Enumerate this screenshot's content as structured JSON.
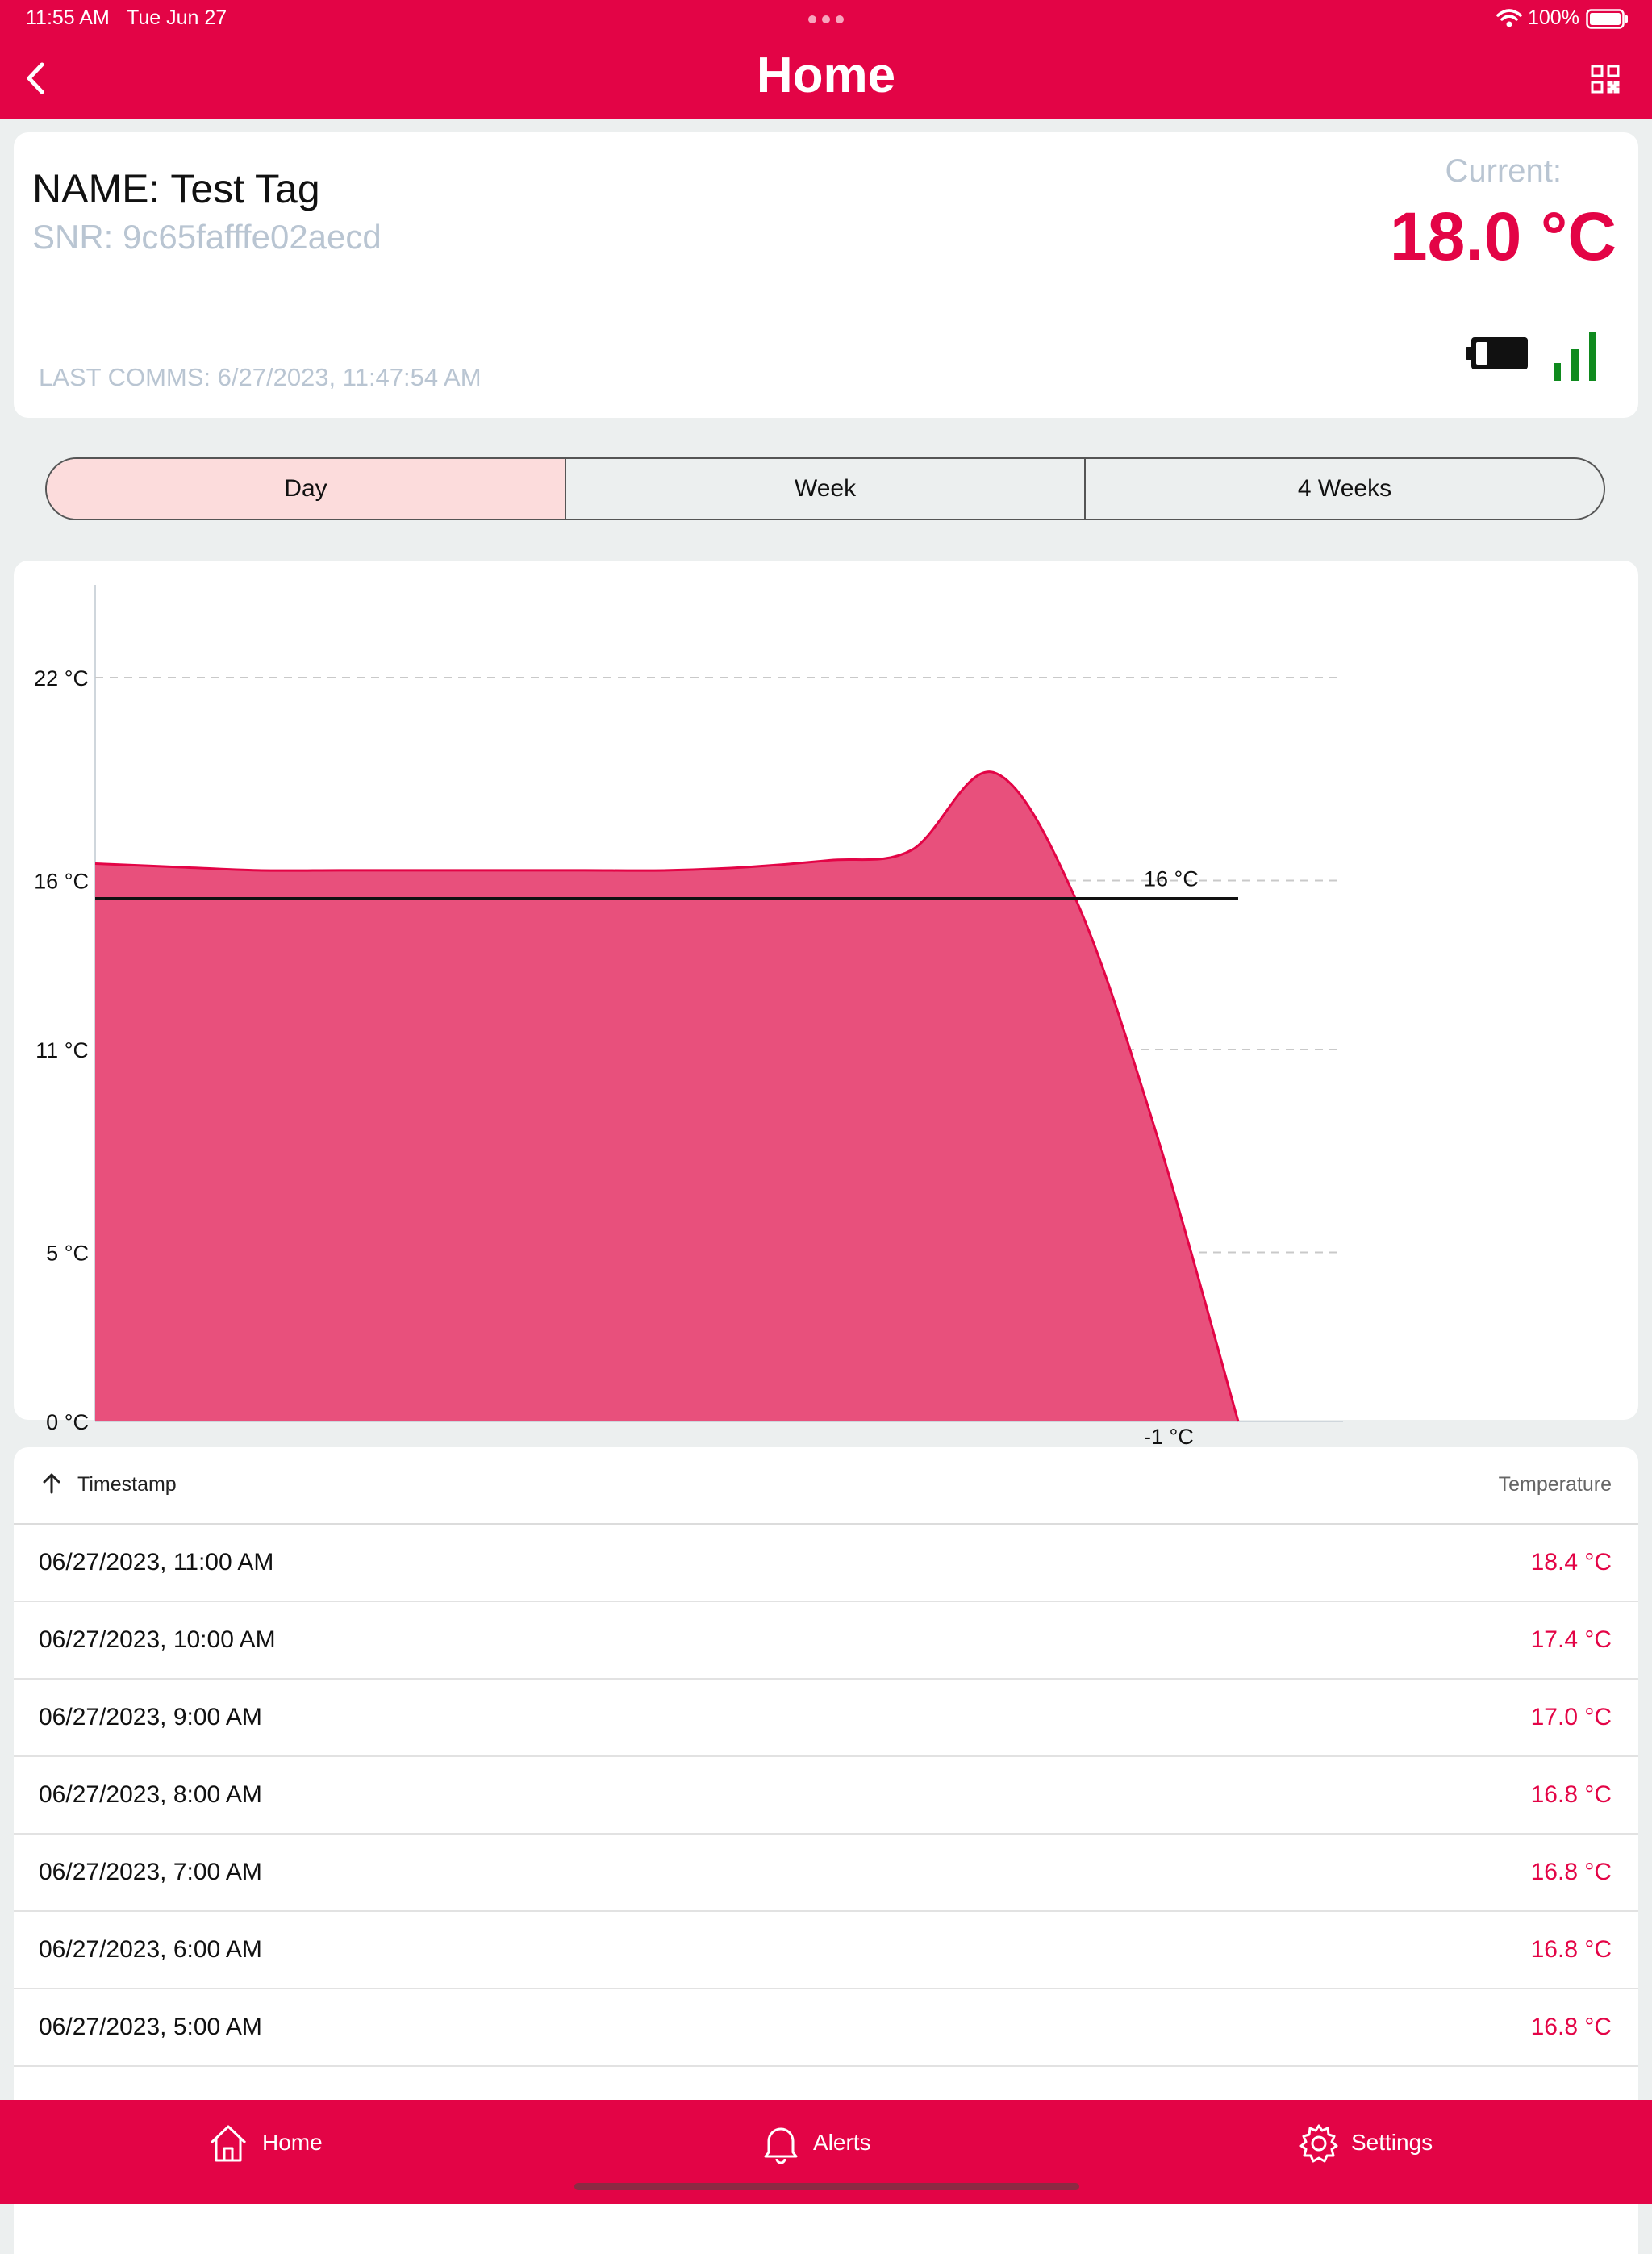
{
  "status_bar": {
    "time": "11:55 AM",
    "date": "Tue Jun 27",
    "battery": "100%"
  },
  "nav": {
    "title": "Home"
  },
  "tag": {
    "name": "NAME: Test Tag",
    "snr": "SNR: 9c65fafffe02aecd",
    "last_comms": "LAST COMMS: 6/27/2023, 11:47:54 AM",
    "current_label": "Current:",
    "current_value": "18.0 °C"
  },
  "segments": [
    "Day",
    "Week",
    "4 Weeks"
  ],
  "chart_data": {
    "type": "area",
    "y_ticks": [
      "22 °C",
      "16 °C",
      "11 °C",
      "5 °C",
      "0 °C"
    ],
    "y_tick_values": [
      22,
      16,
      11,
      5,
      0
    ],
    "ylim": [
      0,
      22
    ],
    "grid": true,
    "series": [
      {
        "values": [
          16.5,
          16.4,
          16.3,
          16.3,
          16.3,
          16.3,
          16.3,
          16.3,
          16.4,
          16.6,
          16.9,
          19.2,
          15.5,
          8.5,
          0
        ]
      }
    ],
    "reference_line": {
      "value": 16,
      "label": "16 °C"
    },
    "min_label": "-1 °C",
    "fill_color": "#e8507c",
    "line_color": "#e30446"
  },
  "table": {
    "col_timestamp": "Timestamp",
    "col_temperature": "Temperature",
    "rows": [
      {
        "timestamp": "06/27/2023, 11:00 AM",
        "temperature": "18.4 °C"
      },
      {
        "timestamp": "06/27/2023, 10:00 AM",
        "temperature": "17.4 °C"
      },
      {
        "timestamp": "06/27/2023, 9:00 AM",
        "temperature": "17.0 °C"
      },
      {
        "timestamp": "06/27/2023, 8:00 AM",
        "temperature": "16.8 °C"
      },
      {
        "timestamp": "06/27/2023, 7:00 AM",
        "temperature": "16.8 °C"
      },
      {
        "timestamp": "06/27/2023, 6:00 AM",
        "temperature": "16.8 °C"
      },
      {
        "timestamp": "06/27/2023, 5:00 AM",
        "temperature": "16.8 °C"
      }
    ]
  },
  "tabbar": {
    "home": "Home",
    "alerts": "Alerts",
    "settings": "Settings"
  },
  "colors": {
    "brand": "#e30446",
    "active_segment": "#fcdcdc",
    "signal": "#0f8a1e"
  }
}
